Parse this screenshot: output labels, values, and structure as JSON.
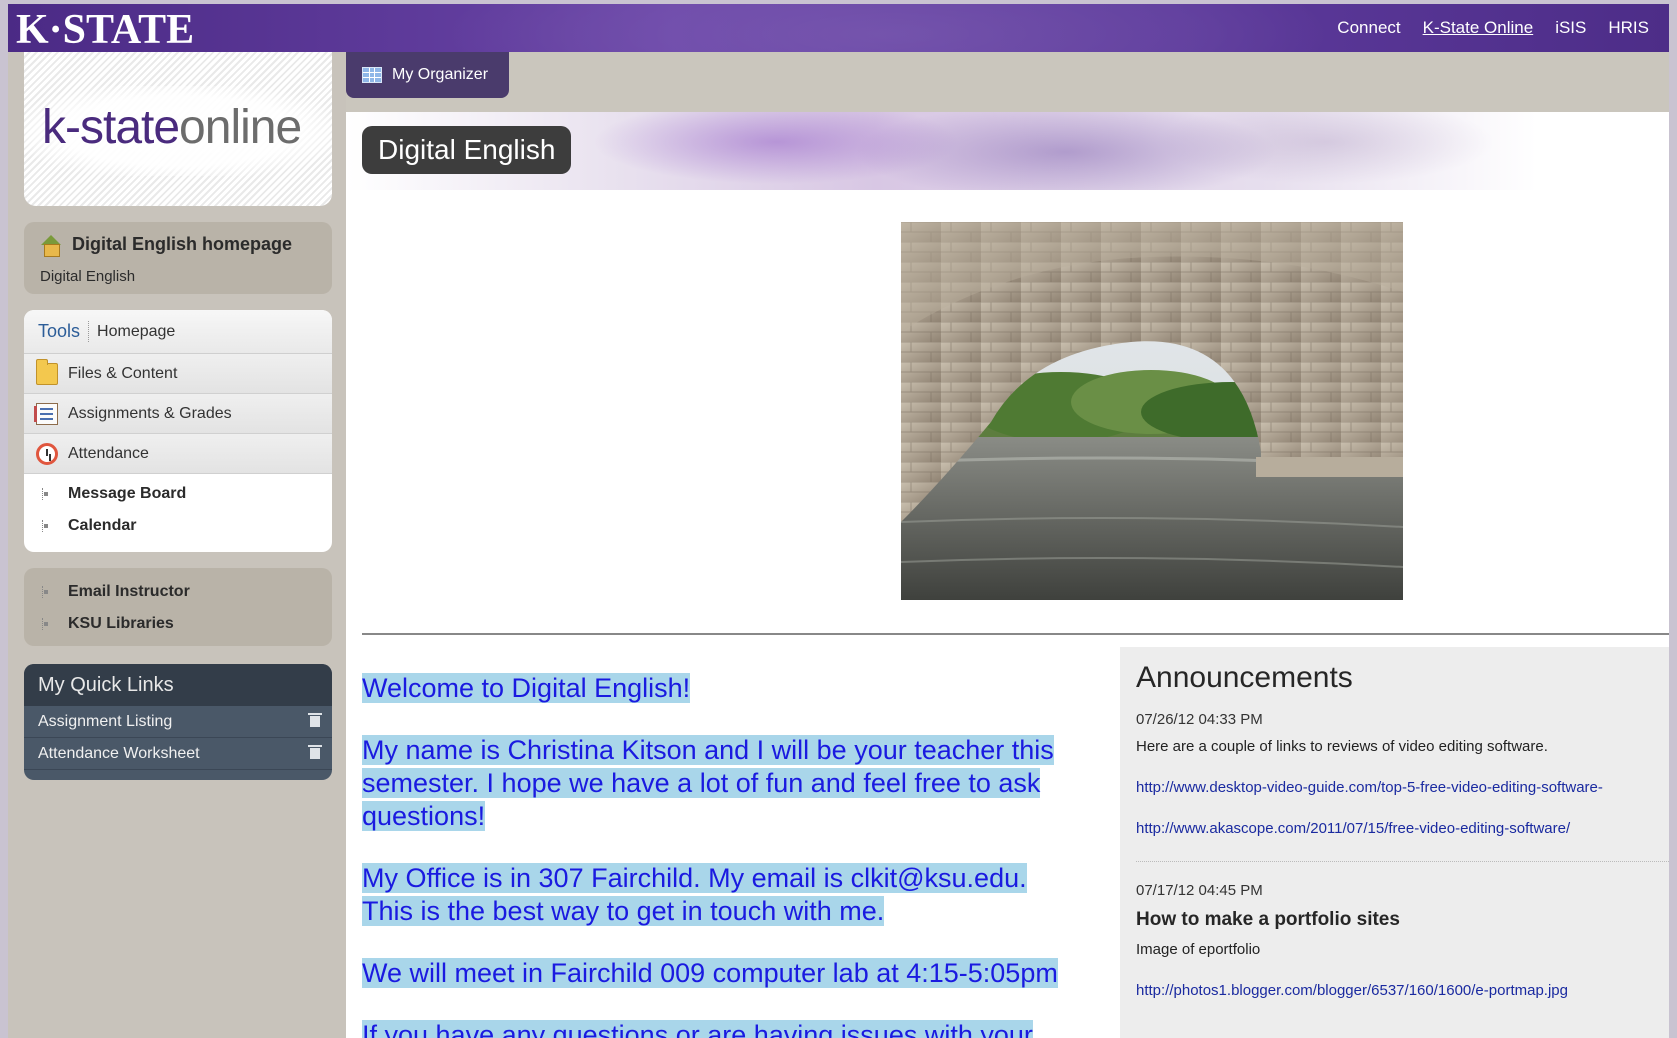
{
  "header": {
    "logo": "K·STATE",
    "links": [
      "Connect",
      "K-State Online",
      "iSIS",
      "HRIS"
    ]
  },
  "sidebar": {
    "brand_a": "k-state",
    "brand_b": "online",
    "home_title": "Digital English homepage",
    "home_sub": "Digital English",
    "tools_tab": "Tools",
    "homepage_tab": "Homepage",
    "tools": [
      {
        "label": "Files & Content",
        "icon": "folder-icon"
      },
      {
        "label": "Assignments & Grades",
        "icon": "notebook-icon"
      },
      {
        "label": "Attendance",
        "icon": "clock-icon"
      }
    ],
    "links": [
      "Message Board",
      "Calendar"
    ],
    "external": [
      "Email Instructor",
      "KSU Libraries"
    ],
    "quick_title": "My Quick Links",
    "quick_links": [
      "Assignment Listing",
      "Attendance Worksheet"
    ]
  },
  "main": {
    "organizer": "My Organizer",
    "course_title": "Digital English",
    "welcome": [
      "Welcome to Digital English!",
      "My name is Christina Kitson and I will be your teacher this semester.  I hope we have a lot of fun and feel free to ask questions!",
      "My Office is in 307 Fairchild.  My email is clkit@ksu.edu.  This is the best way to get in touch with me.",
      "We will meet in Fairchild 009 computer lab at 4:15-5:05pm",
      "If you have any questions or are having issues with your"
    ]
  },
  "announcements": {
    "heading": "Announcements",
    "items": [
      {
        "date": "07/26/12 04:33 PM",
        "text": "Here are a couple of links to reviews of video editing software.",
        "links": [
          "http://www.desktop-video-guide.com/top-5-free-video-editing-software-",
          "http://www.akascope.com/2011/07/15/free-video-editing-software/"
        ]
      },
      {
        "date": "07/17/12 04:45 PM",
        "title": "How to make a portfolio sites",
        "text": "Image of eportfolio",
        "links": [
          "http://photos1.blogger.com/blogger/6537/160/1600/e-portmap.jpg"
        ]
      }
    ]
  },
  "colors": {
    "accent_purple": "#512888",
    "link_blue": "#1a1ae0",
    "highlight": "#a9d6ea"
  }
}
